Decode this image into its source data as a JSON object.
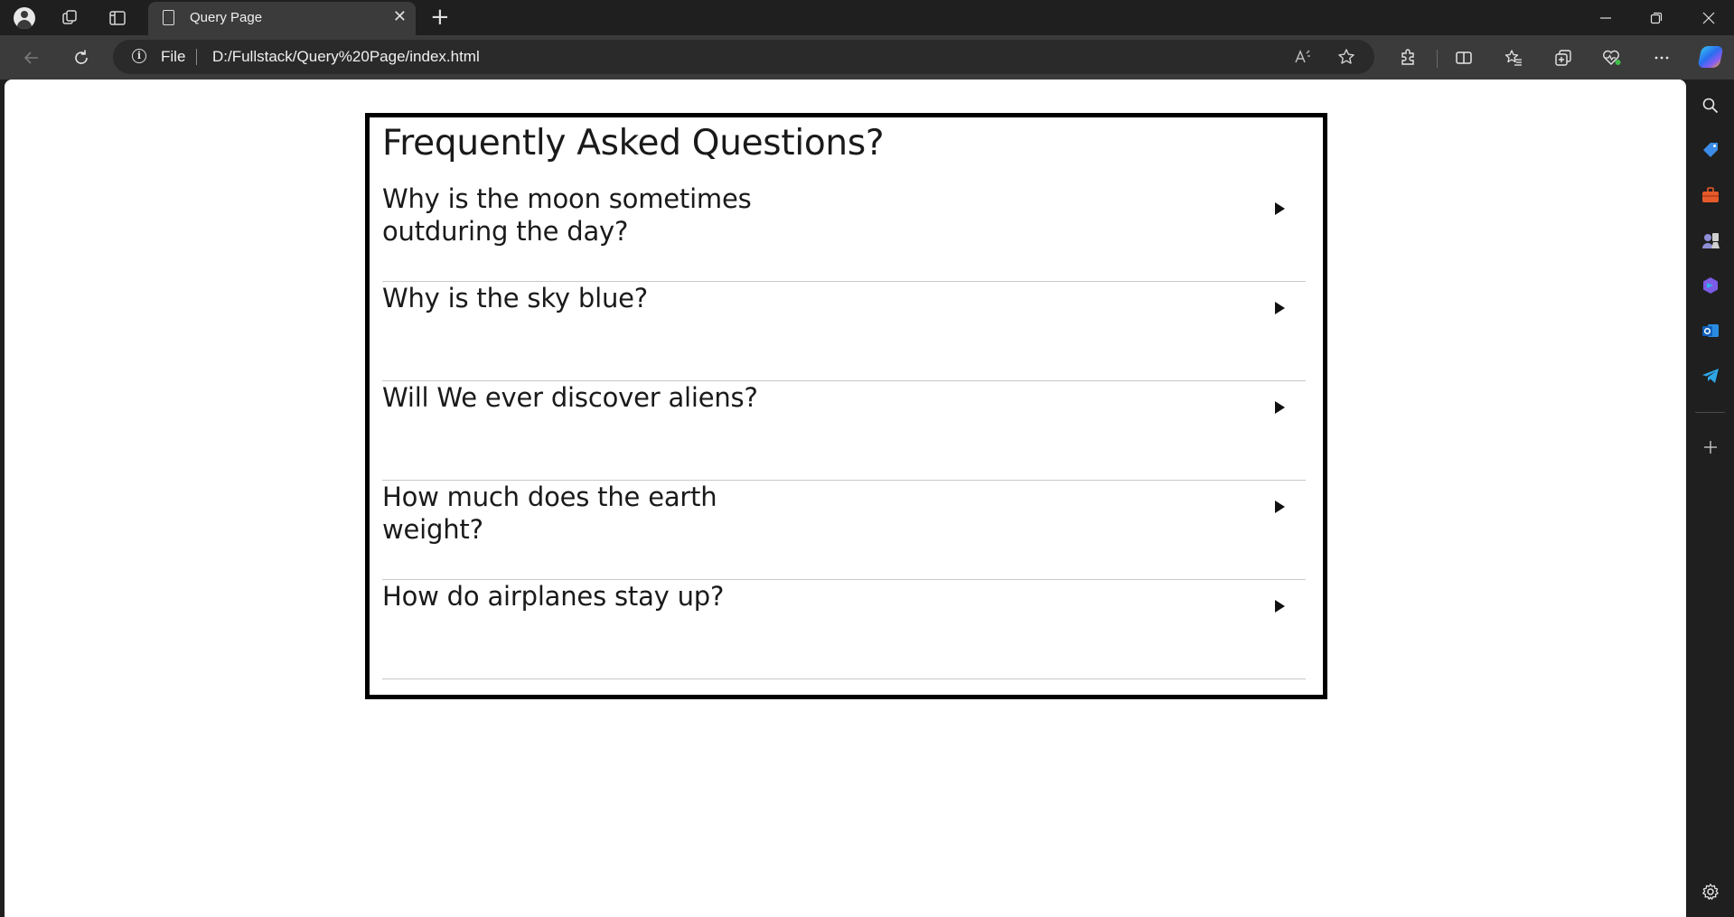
{
  "browser": {
    "tab_title": "Query Page",
    "address_scheme_label": "File",
    "url": "D:/Fullstack/Query%20Page/index.html"
  },
  "icons": {
    "title_bar": [
      "profile-icon",
      "workspaces-icon",
      "vertical-tabs-icon",
      "page-icon",
      "close-tab-icon",
      "new-tab-icon",
      "minimize-icon",
      "restore-icon",
      "close-window-icon"
    ],
    "toolbar": [
      "back-icon",
      "refresh-icon",
      "info-icon",
      "read-aloud-icon",
      "favorite-star-icon",
      "extensions-icon",
      "split-screen-icon",
      "favorites-icon",
      "collections-icon",
      "browser-essentials-icon",
      "more-icon",
      "copilot-icon"
    ],
    "sidebar": [
      "search-icon",
      "shopping-icon",
      "tools-icon",
      "games-icon",
      "microsoft-365-icon",
      "outlook-icon",
      "telegram-icon",
      "add-icon",
      "settings-icon"
    ]
  },
  "faq": {
    "title": "Frequently Asked Questions?",
    "items": [
      {
        "question": "Why is the moon sometimes outduring the day?"
      },
      {
        "question": "Why is the sky blue?"
      },
      {
        "question": "Will We ever discover aliens?"
      },
      {
        "question": "How much does the earth weight?"
      },
      {
        "question": "How do airplanes stay up?"
      }
    ]
  },
  "colors": {
    "browser_chrome": "#1f1f1f",
    "toolbar": "#3b3b3b",
    "page_background": "#ffffff",
    "faq_border": "#000000",
    "divider": "#c8c8c8",
    "text": "#1a1a1a"
  }
}
